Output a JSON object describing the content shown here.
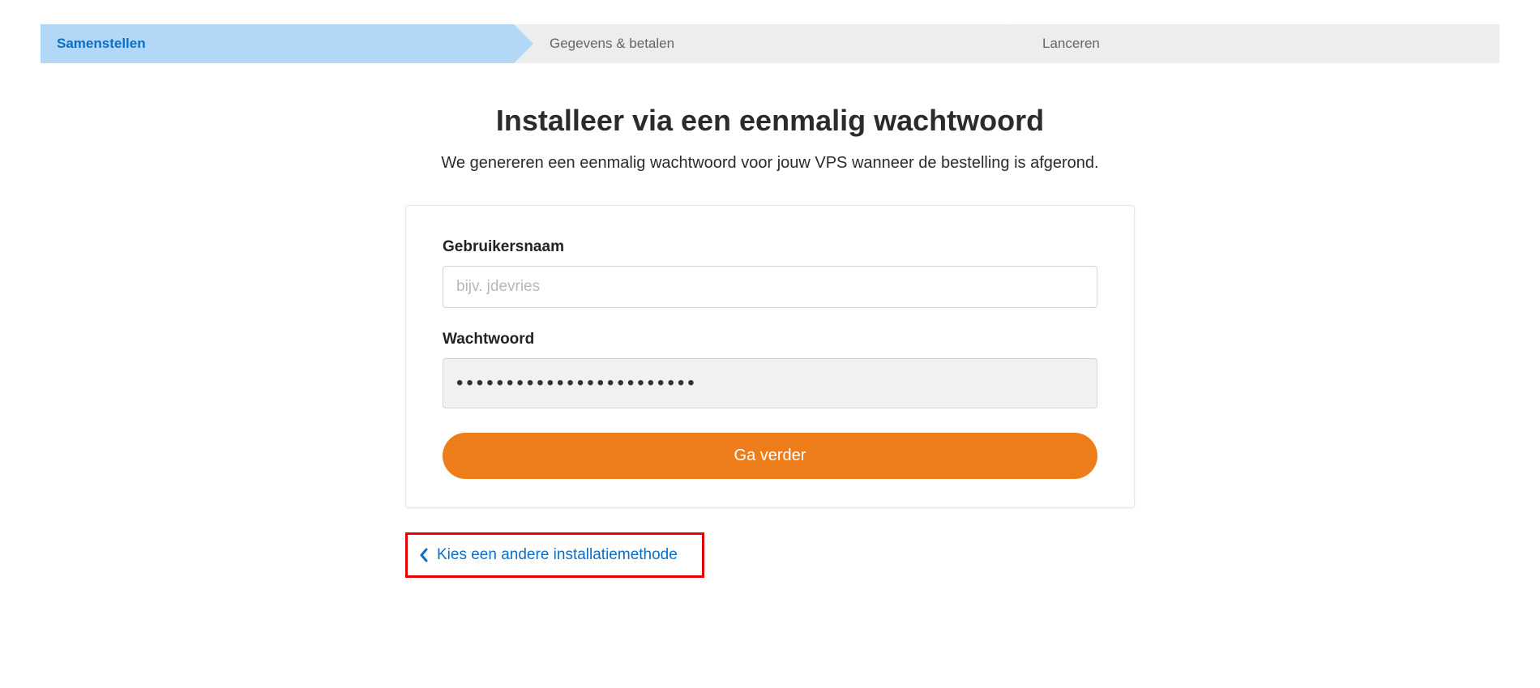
{
  "stepper": {
    "steps": [
      {
        "label": "Samenstellen",
        "active": true
      },
      {
        "label": "Gegevens & betalen",
        "active": false
      },
      {
        "label": "Lanceren",
        "active": false
      }
    ]
  },
  "page": {
    "title": "Installeer via een eenmalig wachtwoord",
    "subtitle": "We genereren een eenmalig wachtwoord voor jouw VPS wanneer de bestelling is afgerond."
  },
  "form": {
    "username_label": "Gebruikersnaam",
    "username_placeholder": "bijv. jdevries",
    "username_value": "",
    "password_label": "Wachtwoord",
    "password_dots": "••••••••••••••••••••••••",
    "submit_label": "Ga verder"
  },
  "back_link": {
    "label": "Kies een andere installatiemethode"
  },
  "colors": {
    "accent_blue": "#0b6fc5",
    "accent_orange": "#ed7d1a",
    "step_active_bg": "#b2d7f7",
    "step_inactive_bg": "#ededed",
    "highlight_border": "#e60000"
  }
}
